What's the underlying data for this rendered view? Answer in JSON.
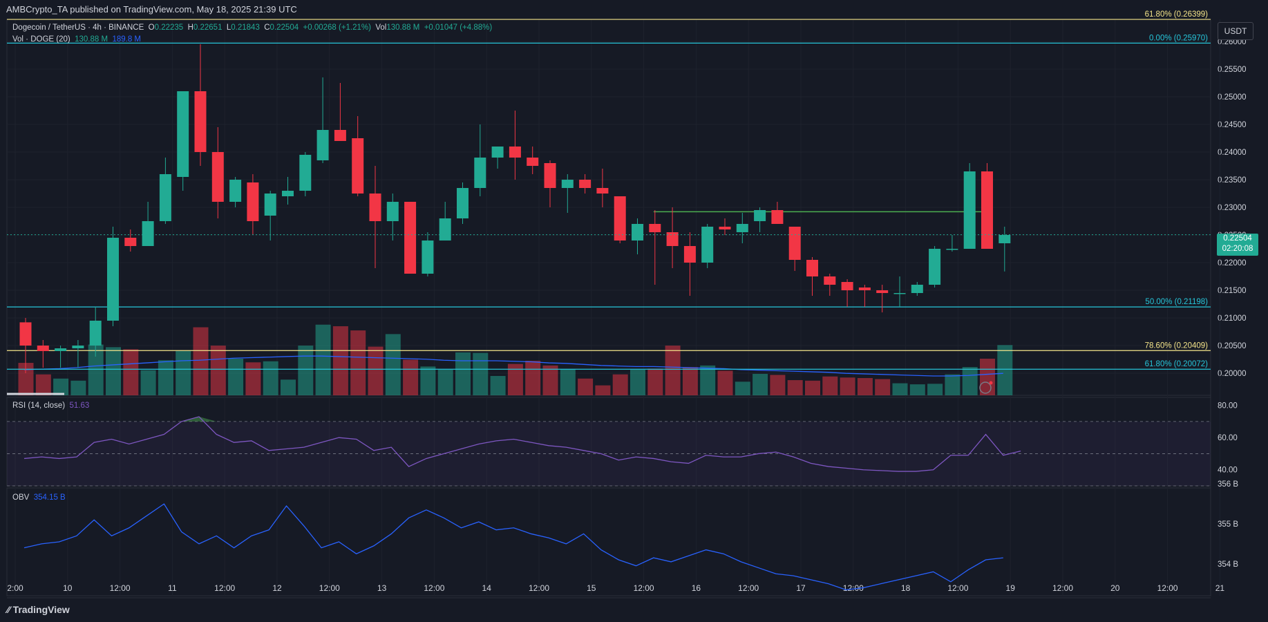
{
  "header": {
    "published": "AMBCrypto_TA published on TradingView.com, May 18, 2025 21:39 UTC"
  },
  "symbol": {
    "name": "Dogecoin / TetherUS · 4h · BINANCE",
    "o_label": "O",
    "o": "0.22235",
    "h_label": "H",
    "h": "0.22651",
    "l_label": "L",
    "l": "0.21843",
    "c_label": "C",
    "c": "0.22504",
    "change": "+0.00268 (+1.21%)",
    "vol_label": "Vol",
    "vol": "130.88 M",
    "vol_change": "+0.01047 (+4.88%)"
  },
  "vol_legend": {
    "label": "Vol · DOGE (20)",
    "v1": "130.88 M",
    "v2": "189.8 M"
  },
  "rsi_legend": {
    "label": "RSI (14, close)",
    "value": "51.63"
  },
  "obv_legend": {
    "label": "OBV",
    "value": "354.15 B"
  },
  "currency_button": "USDT",
  "last_price": {
    "price": "0.22504",
    "countdown": "02:20:08"
  },
  "footer": {
    "brand": "TradingView"
  },
  "colors": {
    "bg": "#161a25",
    "up": "#22ab94",
    "down": "#f23645",
    "fib": "#26c6da",
    "fib_gold": "#f5e58a",
    "rsi": "#7e57c2",
    "obv": "#2962ff",
    "level": "#4caf50"
  },
  "chart_data": {
    "type": "candlestick",
    "ylim": [
      0.196,
      0.264
    ],
    "x_axis_labels": [
      "2:00",
      "10",
      "12:00",
      "11",
      "12:00",
      "12",
      "12:00",
      "13",
      "12:00",
      "14",
      "12:00",
      "15",
      "12:00",
      "16",
      "12:00",
      "17",
      "12:00",
      "18",
      "12:00",
      "19",
      "12:00",
      "20",
      "12:00",
      "21"
    ],
    "price_ticks": [
      "0.26000",
      "0.25500",
      "0.25000",
      "0.24500",
      "0.24000",
      "0.23500",
      "0.23000",
      "0.22500",
      "0.22000",
      "0.21500",
      "0.21000",
      "0.20500",
      "0.20000"
    ],
    "fib_levels": [
      {
        "label": "61.80% (0.26399)",
        "price": 0.26399,
        "color": "#f5e58a"
      },
      {
        "label": "0.00% (0.25970)",
        "price": 0.2597,
        "color": "#26c6da"
      },
      {
        "label": "50.00% (0.21198)",
        "price": 0.21198,
        "color": "#26c6da"
      },
      {
        "label": "78.60% (0.20409)",
        "price": 0.20409,
        "color": "#f5e58a"
      },
      {
        "label": "61.80% (0.20072)",
        "price": 0.20072,
        "color": "#26c6da"
      }
    ],
    "resistance_level": 0.2292,
    "candles": [
      [
        0.2092,
        0.21,
        0.2,
        0.205
      ],
      [
        0.205,
        0.206,
        0.201,
        0.204
      ],
      [
        0.204,
        0.205,
        0.201,
        0.2045
      ],
      [
        0.2045,
        0.206,
        0.201,
        0.205
      ],
      [
        0.205,
        0.212,
        0.203,
        0.2095
      ],
      [
        0.2095,
        0.2265,
        0.2085,
        0.2245
      ],
      [
        0.2245,
        0.226,
        0.222,
        0.223
      ],
      [
        0.223,
        0.231,
        0.223,
        0.2275
      ],
      [
        0.2275,
        0.239,
        0.227,
        0.236
      ],
      [
        0.2355,
        0.251,
        0.233,
        0.251
      ],
      [
        0.251,
        0.2595,
        0.2375,
        0.24
      ],
      [
        0.24,
        0.2445,
        0.228,
        0.231
      ],
      [
        0.231,
        0.2355,
        0.23,
        0.235
      ],
      [
        0.2345,
        0.236,
        0.225,
        0.2275
      ],
      [
        0.2285,
        0.233,
        0.224,
        0.2325
      ],
      [
        0.232,
        0.2355,
        0.2305,
        0.233
      ],
      [
        0.233,
        0.24,
        0.232,
        0.2395
      ],
      [
        0.2385,
        0.2535,
        0.238,
        0.244
      ],
      [
        0.244,
        0.2525,
        0.2425,
        0.242
      ],
      [
        0.2425,
        0.2465,
        0.232,
        0.2325
      ],
      [
        0.2325,
        0.2375,
        0.219,
        0.2275
      ],
      [
        0.2275,
        0.2325,
        0.224,
        0.231
      ],
      [
        0.231,
        0.231,
        0.218,
        0.218
      ],
      [
        0.218,
        0.2255,
        0.2175,
        0.224
      ],
      [
        0.224,
        0.231,
        0.224,
        0.228
      ],
      [
        0.228,
        0.2345,
        0.227,
        0.2335
      ],
      [
        0.2335,
        0.245,
        0.232,
        0.239
      ],
      [
        0.239,
        0.241,
        0.237,
        0.241
      ],
      [
        0.241,
        0.2475,
        0.235,
        0.239
      ],
      [
        0.239,
        0.241,
        0.236,
        0.2375
      ],
      [
        0.238,
        0.2385,
        0.23,
        0.2335
      ],
      [
        0.2335,
        0.236,
        0.229,
        0.235
      ],
      [
        0.235,
        0.236,
        0.2325,
        0.2335
      ],
      [
        0.2335,
        0.237,
        0.23,
        0.2325
      ],
      [
        0.232,
        0.232,
        0.2235,
        0.224
      ],
      [
        0.224,
        0.228,
        0.2215,
        0.227
      ],
      [
        0.227,
        0.2295,
        0.216,
        0.2255
      ],
      [
        0.2255,
        0.23,
        0.219,
        0.223
      ],
      [
        0.223,
        0.2255,
        0.214,
        0.22
      ],
      [
        0.22,
        0.227,
        0.219,
        0.2265
      ],
      [
        0.2265,
        0.228,
        0.225,
        0.226
      ],
      [
        0.2255,
        0.229,
        0.2235,
        0.227
      ],
      [
        0.2275,
        0.23,
        0.2255,
        0.2295
      ],
      [
        0.2295,
        0.231,
        0.227,
        0.227
      ],
      [
        0.2265,
        0.2265,
        0.2185,
        0.2205
      ],
      [
        0.2205,
        0.221,
        0.214,
        0.2175
      ],
      [
        0.2175,
        0.218,
        0.214,
        0.216
      ],
      [
        0.2165,
        0.217,
        0.212,
        0.215
      ],
      [
        0.2155,
        0.216,
        0.212,
        0.215
      ],
      [
        0.215,
        0.216,
        0.211,
        0.2145
      ],
      [
        0.2145,
        0.2175,
        0.212,
        0.2145
      ],
      [
        0.2145,
        0.2165,
        0.214,
        0.216
      ],
      [
        0.216,
        0.223,
        0.2155,
        0.2225
      ],
      [
        0.2225,
        0.225,
        0.222,
        0.2225
      ],
      [
        0.2225,
        0.238,
        0.2225,
        0.2365
      ],
      [
        0.2365,
        0.238,
        0.2225,
        0.2225
      ],
      [
        0.2235,
        0.2265,
        0.2184,
        0.225
      ]
    ],
    "volume_series": {
      "name": "Vol · DOGE (20)",
      "values": [
        62,
        40,
        32,
        28,
        97,
        92,
        88,
        48,
        67,
        85,
        130,
        95,
        70,
        63,
        65,
        30,
        95,
        135,
        132,
        124,
        93,
        117,
        68,
        55,
        49,
        82,
        81,
        37,
        60,
        66,
        57,
        50,
        32,
        19,
        40,
        49,
        51,
        95,
        54,
        57,
        47,
        26,
        41,
        39,
        29,
        28,
        36,
        34,
        33,
        31,
        23,
        21,
        22,
        40,
        54,
        70,
        96
      ]
    },
    "volume_ma": [
      49,
      50,
      51,
      53,
      56,
      58,
      60,
      62,
      64,
      66,
      67,
      69,
      71,
      72,
      73,
      74,
      75,
      75,
      74,
      73,
      72,
      71,
      70,
      69,
      67,
      66,
      66,
      66,
      65,
      64,
      62,
      61,
      59,
      57,
      56,
      55,
      55,
      54,
      53,
      52,
      51,
      49,
      48,
      47,
      46,
      45,
      44,
      42,
      41,
      40,
      39,
      38,
      37,
      37,
      38,
      40,
      42
    ],
    "rsi_series": {
      "name": "RSI (14, close)",
      "values": [
        47,
        48,
        47,
        48,
        57,
        59,
        56,
        59,
        62,
        70,
        73,
        62,
        57,
        58,
        52,
        53,
        54,
        57,
        60,
        59,
        52,
        54,
        42,
        47,
        50,
        53,
        56,
        58,
        59,
        57,
        55,
        54,
        52,
        50,
        46,
        48,
        47,
        45,
        44,
        49,
        48,
        48,
        50,
        51,
        48,
        44,
        42,
        41,
        40,
        39.5,
        39,
        39,
        40,
        49,
        49,
        62,
        49,
        51.63
      ]
    },
    "rsi_ylim": [
      30,
      85
    ],
    "rsi_ticks": [
      "80.00",
      "60.00",
      "40.00"
    ],
    "obv_series": {
      "name": "OBV",
      "values": [
        354.4,
        354.5,
        354.55,
        354.7,
        355.1,
        354.7,
        354.9,
        355.2,
        355.5,
        354.8,
        354.5,
        354.7,
        354.4,
        354.7,
        354.85,
        355.45,
        354.95,
        354.4,
        354.55,
        354.25,
        354.45,
        354.75,
        355.15,
        355.35,
        355.15,
        354.9,
        355.05,
        354.85,
        354.9,
        354.75,
        354.65,
        354.5,
        354.75,
        354.35,
        354.1,
        353.95,
        354.15,
        354.05,
        354.2,
        354.35,
        354.25,
        354.05,
        353.9,
        353.75,
        353.7,
        353.6,
        353.5,
        353.35,
        353.4,
        353.5,
        353.6,
        353.7,
        353.8,
        353.55,
        353.85,
        354.1,
        354.15
      ]
    },
    "obv_ylim": [
      353.2,
      355.9
    ],
    "obv_ticks": [
      "356 B",
      "355 B",
      "354 B"
    ]
  }
}
